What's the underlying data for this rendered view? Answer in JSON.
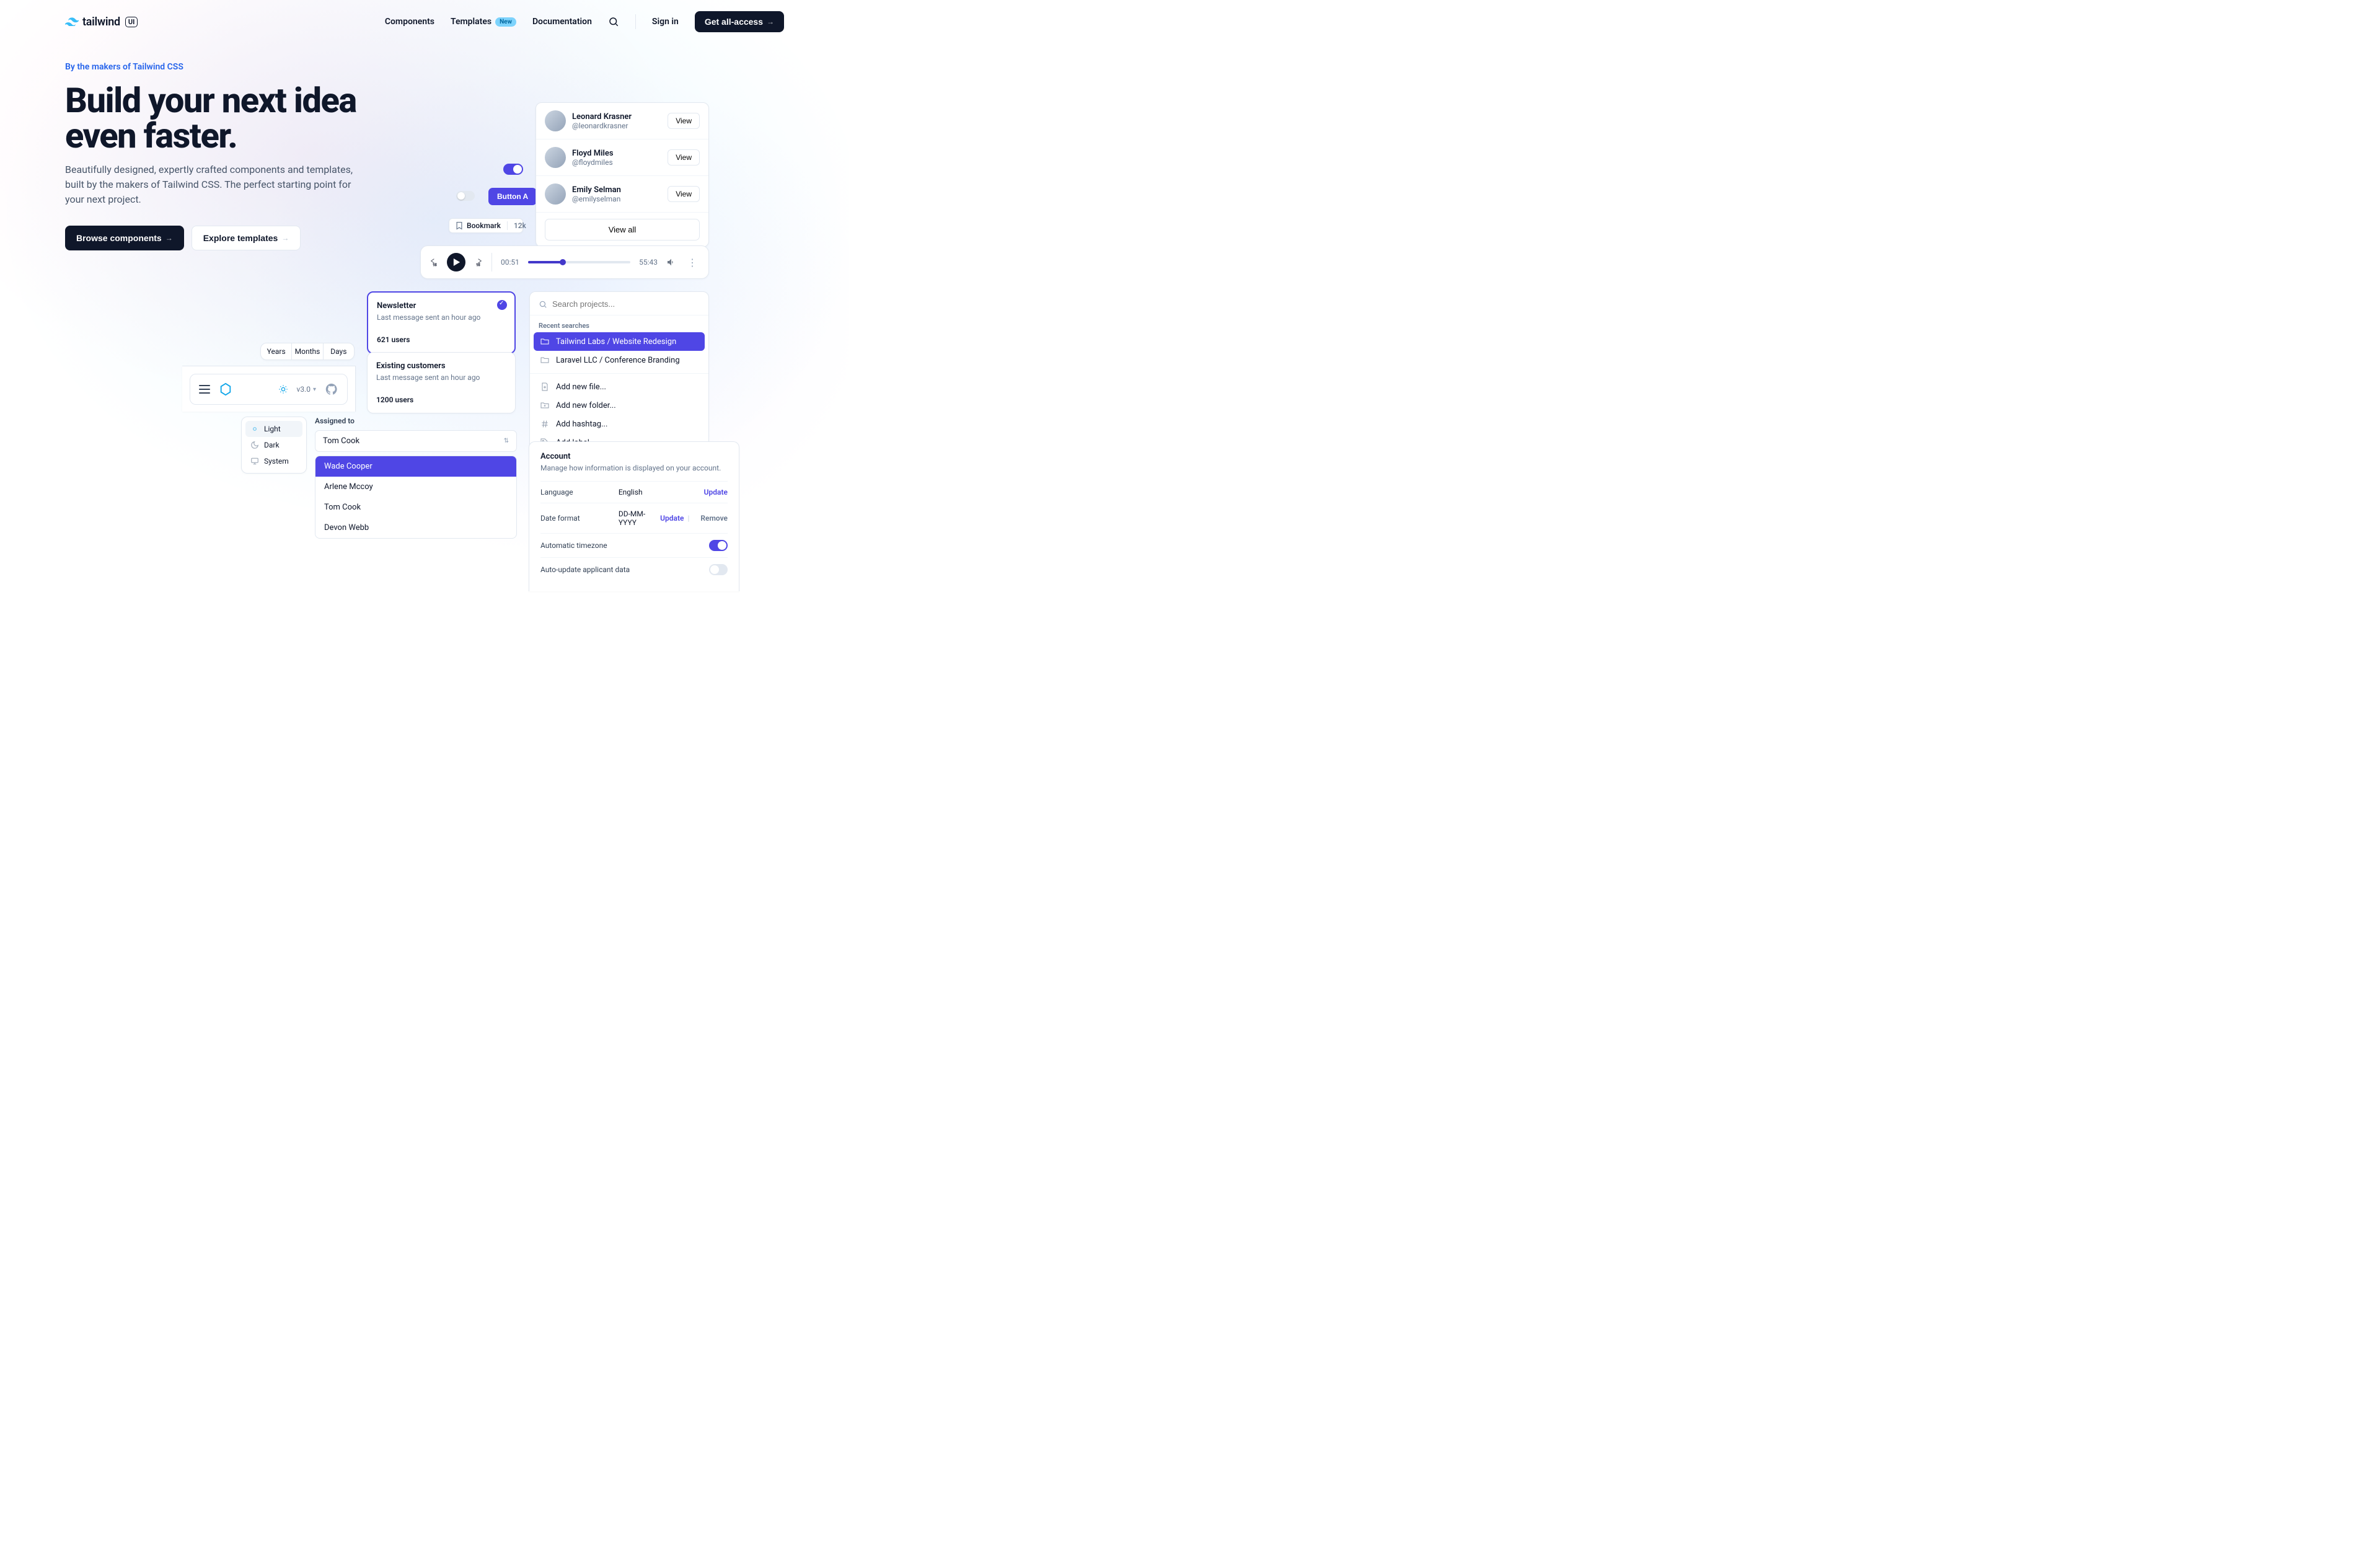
{
  "brand": {
    "name": "tailwind",
    "suffix": "UI"
  },
  "nav": {
    "components": "Components",
    "templates": "Templates",
    "templates_badge": "New",
    "documentation": "Documentation",
    "signin": "Sign in",
    "get_access": "Get all-access"
  },
  "hero": {
    "eyebrow": "By the makers of Tailwind CSS",
    "headline_a": "Build your next idea",
    "headline_b": "even faster.",
    "sub": "Beautifully designed, expertly crafted components and templates, built by the makers of Tailwind CSS. The perfect starting point for your next project.",
    "browse": "Browse components",
    "explore": "Explore templates"
  },
  "button_a": "Button A",
  "bookmark": {
    "label": "Bookmark",
    "count": "12k"
  },
  "people": [
    {
      "name": "Leonard Krasner",
      "handle": "@leonardkrasner",
      "action": "View"
    },
    {
      "name": "Floyd Miles",
      "handle": "@floydmiles",
      "action": "View"
    },
    {
      "name": "Emily Selman",
      "handle": "@emilyselman",
      "action": "View"
    }
  ],
  "people_view_all": "View all",
  "player": {
    "elapsed": "00:51",
    "total": "55:43",
    "skip_back": "15",
    "skip_fwd": "15"
  },
  "newsletter": {
    "a": {
      "title": "Newsletter",
      "sub": "Last message sent an hour ago",
      "stat": "621 users"
    },
    "b": {
      "title": "Existing customers",
      "sub": "Last message sent an hour ago",
      "stat": "1200 users"
    }
  },
  "search": {
    "placeholder": "Search projects...",
    "recent_label": "Recent searches",
    "recent": [
      "Tailwind Labs / Website Redesign",
      "Laravel LLC / Conference Branding"
    ],
    "actions": [
      "Add new file...",
      "Add new folder...",
      "Add hashtag...",
      "Add label..."
    ]
  },
  "tabs": {
    "a": "Years",
    "b": "Months",
    "c": "Days"
  },
  "appshell": {
    "version": "v3.0"
  },
  "theme": {
    "light": "Light",
    "dark": "Dark",
    "system": "System"
  },
  "assign": {
    "label": "Assigned to",
    "selected": "Tom Cook",
    "options": [
      "Wade Cooper",
      "Arlene Mccoy",
      "Tom Cook",
      "Devon Webb"
    ]
  },
  "account": {
    "title": "Account",
    "sub": "Manage how information is displayed on your account.",
    "language_key": "Language",
    "language_val": "English",
    "date_key": "Date format",
    "date_val": "DD-MM-YYYY",
    "update": "Update",
    "remove": "Remove",
    "auto_tz": "Automatic timezone",
    "auto_update": "Auto-update applicant data"
  }
}
